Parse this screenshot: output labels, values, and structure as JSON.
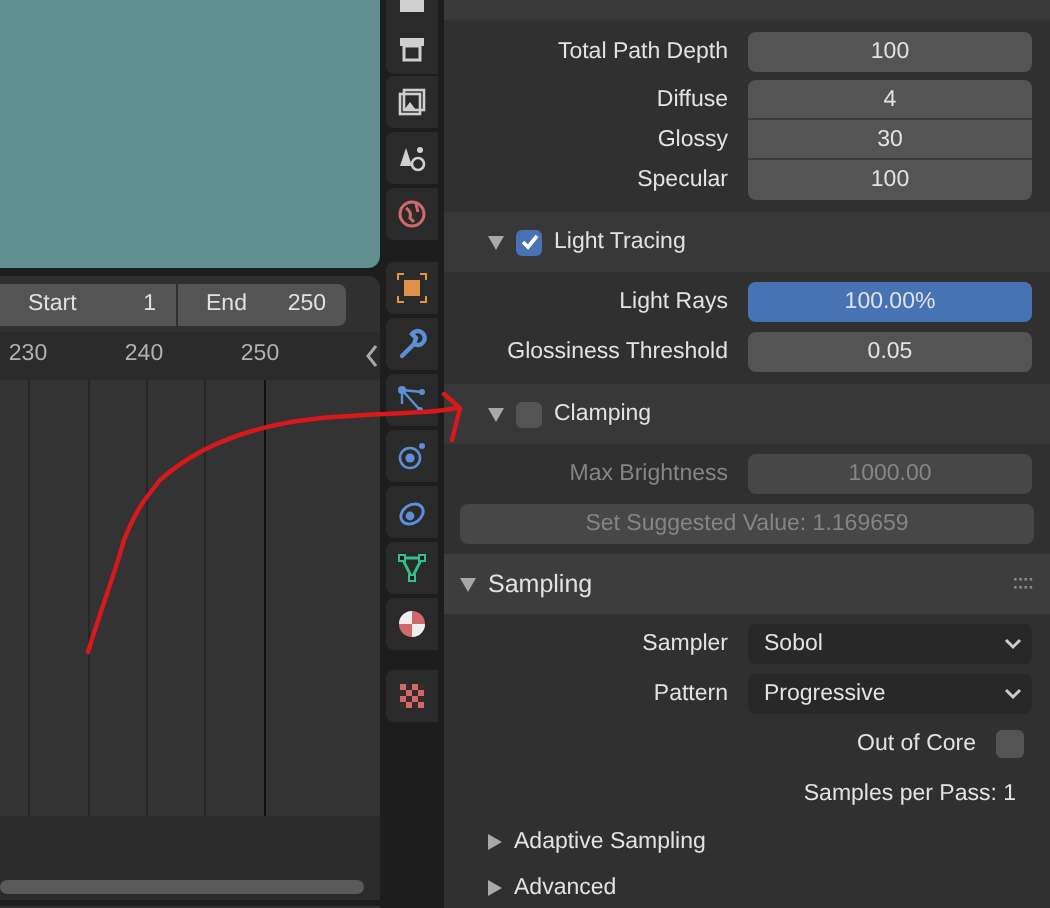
{
  "timeline": {
    "start_label": "Start",
    "start": "1",
    "end_label": "End",
    "end": "250",
    "ruler": [
      "230",
      "240",
      "250"
    ]
  },
  "properties": {
    "rows": [
      {
        "kind": "field",
        "label": "Total Path Depth",
        "value": "100",
        "disabled": false
      },
      {
        "kind": "group",
        "items": [
          {
            "label": "Diffuse",
            "value": "4"
          },
          {
            "label": "Glossy",
            "value": "30"
          },
          {
            "label": "Specular",
            "value": "100"
          }
        ]
      },
      {
        "kind": "subpanel",
        "title": "Light Tracing",
        "expanded": true,
        "checked": true
      },
      {
        "kind": "slider",
        "label": "Light Rays",
        "value": "100.00%",
        "level": 1.0
      },
      {
        "kind": "field",
        "label": "Glossiness Threshold",
        "value": "0.05",
        "disabled": false
      },
      {
        "kind": "subpanel",
        "title": "Clamping",
        "expanded": true,
        "checked": false
      },
      {
        "kind": "field",
        "label": "Max Brightness",
        "value": "1000.00",
        "disabled": true
      },
      {
        "kind": "button",
        "label": "Set Suggested Value: 1.169659",
        "disabled": true
      },
      {
        "kind": "panel",
        "title": "Sampling",
        "expanded": true
      },
      {
        "kind": "dropdown",
        "label": "Sampler",
        "value": "Sobol"
      },
      {
        "kind": "dropdown",
        "label": "Pattern",
        "value": "Progressive"
      },
      {
        "kind": "checkbox",
        "label": "Out of Core",
        "checked": false
      },
      {
        "kind": "info",
        "text": "Samples per Pass: 1"
      },
      {
        "kind": "subpanel",
        "title": "Adaptive Sampling",
        "expanded": false
      },
      {
        "kind": "subpanel",
        "title": "Advanced",
        "expanded": false
      }
    ]
  }
}
